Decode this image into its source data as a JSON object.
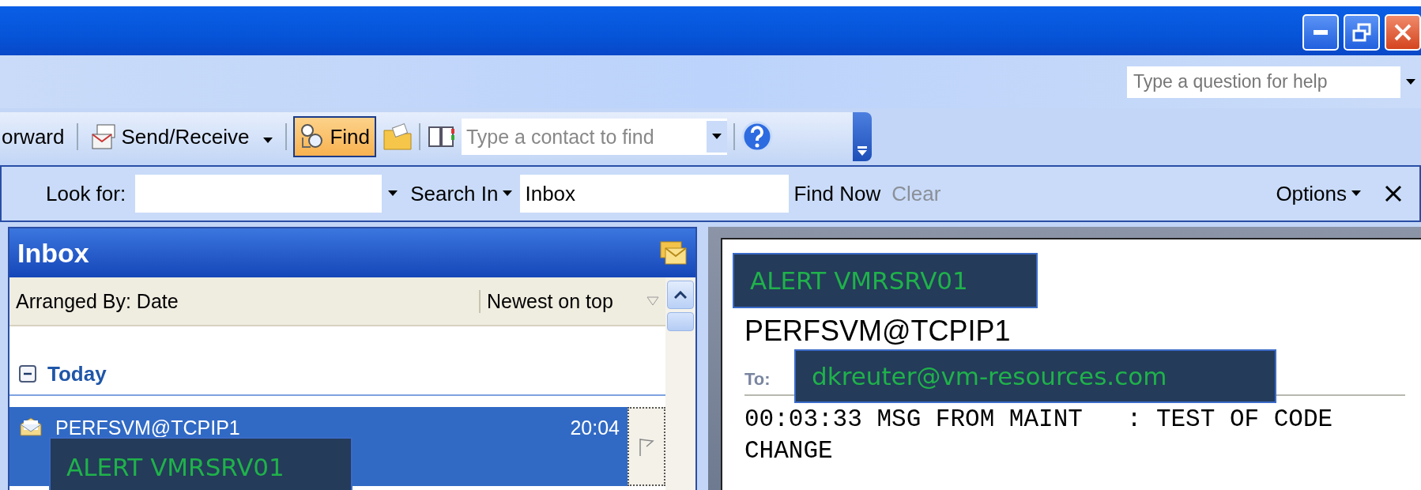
{
  "help_search": {
    "placeholder": "Type a question for help"
  },
  "toolbar": {
    "forward": {
      "label": "orward"
    },
    "send_receive": {
      "label": "Send/Receive"
    },
    "find": {
      "label": "Find",
      "selected": true
    },
    "contact_search": {
      "placeholder": "Type a contact to find"
    }
  },
  "find_bar": {
    "look_for_label": "Look for:",
    "search_in": "Search In",
    "folder": "Inbox",
    "find_now": "Find Now",
    "clear": {
      "label": "Clear",
      "disabled": true
    },
    "options": "Options"
  },
  "inbox": {
    "title": "Inbox",
    "arranged_by": "Arranged By: Date",
    "sort_order": "Newest on top",
    "groups": [
      {
        "label": "Today",
        "expanded": true,
        "messages": [
          {
            "sender": "PERFSVM@TCPIP1",
            "time": "20:04",
            "selected": true
          }
        ]
      }
    ]
  },
  "reading_pane": {
    "sender": "PERFSVM@TCPIP1",
    "to_label": "To:",
    "body": "00:03:33 MSG FROM MAINT   : TEST OF CODE CHANGE"
  },
  "callouts": [
    {
      "text": "ALERT VMRSRV01"
    },
    {
      "text": "dkreuter@vm-resources.com"
    },
    {
      "text": "ALERT VMRSRV01"
    }
  ]
}
